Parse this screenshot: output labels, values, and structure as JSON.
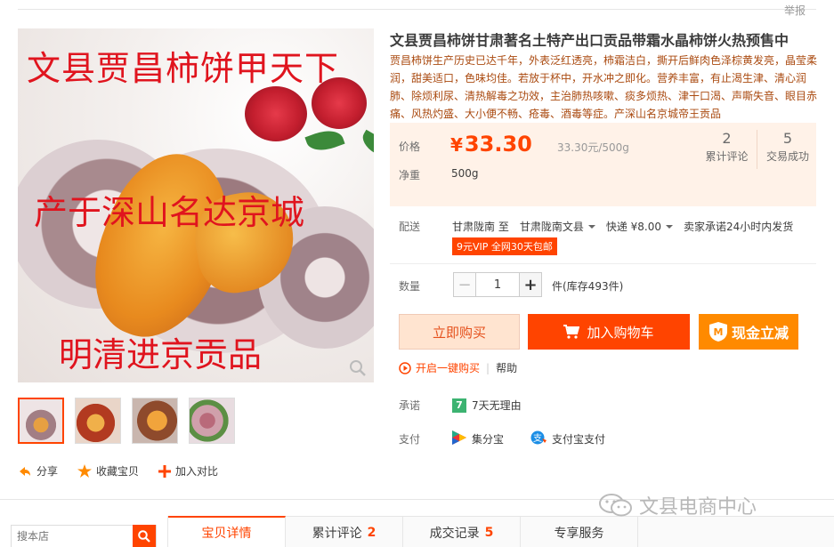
{
  "report_link": "举报",
  "product": {
    "title": "文县贾昌柿饼甘肃著名土特产出口贡品带霜水晶柿饼火热预售中",
    "description": "贾昌柿饼生产历史已达千年，外表泛红透亮，柿霜洁白，撕开后鲜肉色泽棕黄发亮，晶莹柔润，甜美适口，色味均佳。若放于杯中，开水冲之即化。营养丰富，有止渴生津、清心润肺、除烦利尿、清热解毒之功效，主治肺热咳嗽、痰多烦热、津干口渴、声嘶失音、眼目赤痛、风热灼盛、大小便不畅、疮毒、酒毒等症。产深山名京城帝王贡品",
    "image_overlay": {
      "line1": "文县贾昌柿饼甲天下",
      "line2": "产于深山名达京城",
      "line3": "明清进京贡品"
    }
  },
  "price": {
    "label": "价格",
    "currency": "¥",
    "value": "33.30",
    "unit_price": "33.30元/500g",
    "weight_label": "净重",
    "weight_value": "500g"
  },
  "stats": {
    "reviews_count": "2",
    "reviews_label": "累计评论",
    "sales_count": "5",
    "sales_label": "交易成功"
  },
  "shipping": {
    "label": "配送",
    "from": "甘肃陇南 至",
    "to": "甘肃陇南文县",
    "express": "快递 ¥8.00",
    "promise": "卖家承诺24小时内发货",
    "vip_tag": "9元VIP 全网30天包邮"
  },
  "quantity": {
    "label": "数量",
    "value": "1",
    "minus": "−",
    "plus": "+",
    "stock": "件(库存493件)"
  },
  "buttons": {
    "buy_now": "立即购买",
    "add_cart": "加入购物车",
    "cash_discount": "现金立减",
    "one_click": "开启一键购买",
    "help": "帮助"
  },
  "promise": {
    "label": "承诺",
    "seven": "7",
    "text": "7天无理由"
  },
  "payment": {
    "label": "支付",
    "method1": "集分宝",
    "method2": "支付宝支付"
  },
  "left_actions": {
    "share": "分享",
    "favorite": "收藏宝贝",
    "compare": "加入对比"
  },
  "store_search": {
    "placeholder": "搜本店"
  },
  "tabs": [
    {
      "label": "宝贝详情",
      "count": ""
    },
    {
      "label": "累计评论",
      "count": "2"
    },
    {
      "label": "成交记录",
      "count": "5"
    },
    {
      "label": "专享服务",
      "count": ""
    }
  ],
  "watermark": "文县电商中心",
  "colors": {
    "accent": "#ff4400",
    "cash_button": "#ff8a00",
    "price_bg": "#fff2e8"
  }
}
